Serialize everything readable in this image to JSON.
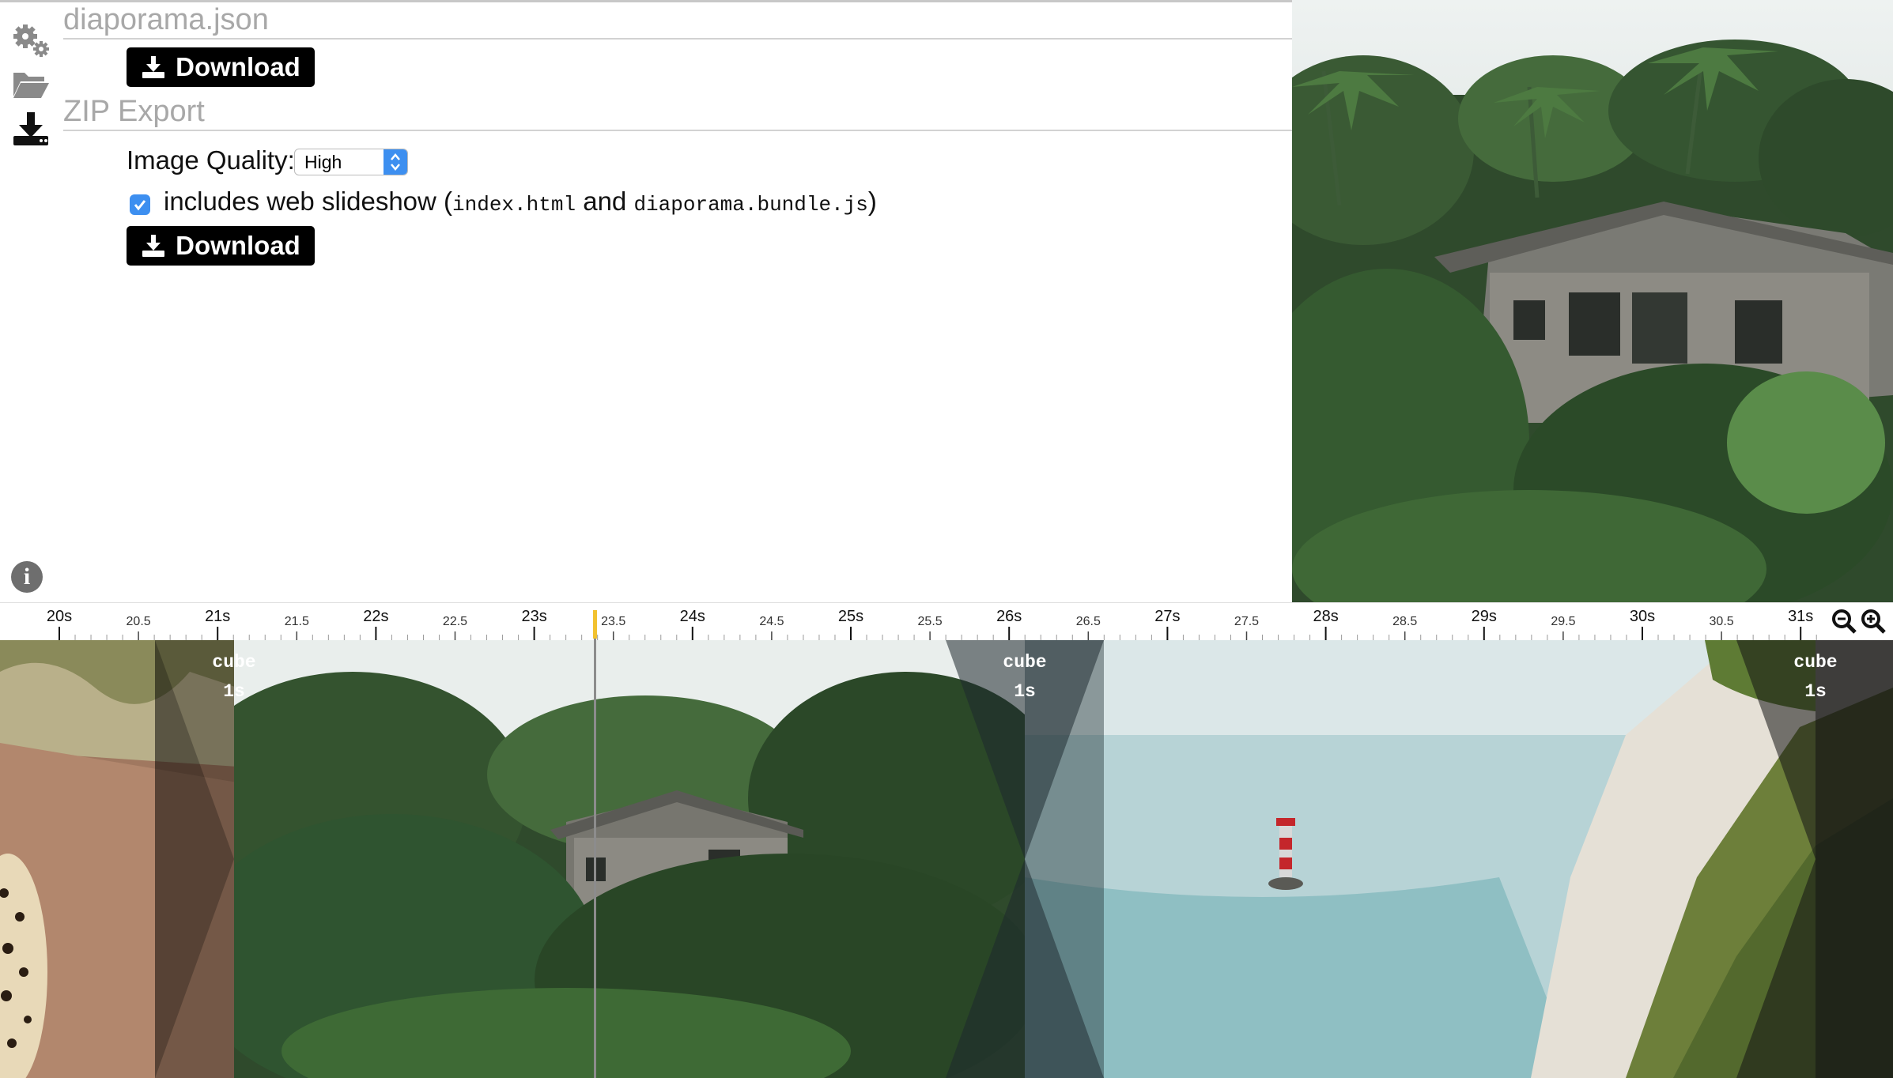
{
  "sidebar": {
    "icons": [
      "gears-icon",
      "folder-open-icon",
      "download-icon"
    ],
    "info_icon": "info-icon"
  },
  "json_section": {
    "title": "diaporama.json",
    "download_label": "Download"
  },
  "zip_section": {
    "title": "ZIP Export",
    "quality_label": "Image Quality:",
    "quality_value": "High",
    "slideshow_checked": true,
    "slideshow_text": "includes web slideshow (",
    "slideshow_file1": "index.html",
    "slideshow_and": " and ",
    "slideshow_file2": "diaporama.bundle.js",
    "slideshow_close": ")",
    "download_label": "Download"
  },
  "ruler": {
    "major": [
      "20s",
      "21s",
      "22s",
      "23s",
      "24s",
      "25s",
      "26s",
      "27s",
      "28s",
      "29s",
      "30s",
      "31s"
    ],
    "minor": [
      "20.5",
      "21.5",
      "22.5",
      "23.5",
      "24.5",
      "25.5",
      "26.5",
      "27.5",
      "28.5",
      "29.5",
      "30.5"
    ],
    "zoom_out": "zoom-out-icon",
    "zoom_in": "zoom-in-icon"
  },
  "timeline": {
    "cursor_time": "23.4s",
    "transitions": [
      {
        "name": "cube",
        "duration": "1s"
      },
      {
        "name": "cube",
        "duration": "1s"
      },
      {
        "name": "cube",
        "duration": "1s"
      }
    ],
    "clips": [
      "leopard-photo",
      "jungle-house-photo",
      "lighthouse-cliff-photo"
    ]
  },
  "colors": {
    "accent": "#3d8ff0",
    "cursor": "#f2c230",
    "button": "#000000"
  }
}
